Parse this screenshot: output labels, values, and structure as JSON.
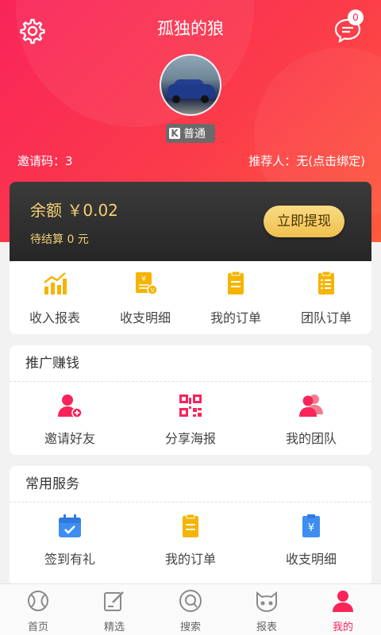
{
  "header": {
    "title": "孤独的狼",
    "message_count": "0",
    "level_badge": "普通",
    "level_icon_letter": "K",
    "invite_code": "邀请码：3",
    "referrer": "推荐人：无(点击绑定)"
  },
  "balance": {
    "label": "余额 ￥0.02",
    "pending": "待结算 0 元",
    "withdraw_button": "立即提现"
  },
  "quick_actions": [
    {
      "label": "收入报表",
      "icon": "chart-icon"
    },
    {
      "label": "收支明细",
      "icon": "ledger-icon"
    },
    {
      "label": "我的订单",
      "icon": "order-icon"
    },
    {
      "label": "团队订单",
      "icon": "team-order-icon"
    }
  ],
  "promo": {
    "title": "推广赚钱",
    "items": [
      {
        "label": "邀请好友",
        "icon": "add-user-icon"
      },
      {
        "label": "分享海报",
        "icon": "qr-code-icon"
      },
      {
        "label": "我的团队",
        "icon": "team-icon"
      }
    ]
  },
  "services": {
    "title": "常用服务",
    "items": [
      {
        "label": "签到有礼",
        "icon": "calendar-check-icon"
      },
      {
        "label": "我的订单",
        "icon": "order-icon"
      },
      {
        "label": "收支明细",
        "icon": "ledger-icon"
      }
    ]
  },
  "tabbar": [
    {
      "label": "首页",
      "icon": "ball-icon"
    },
    {
      "label": "精选",
      "icon": "edit-icon"
    },
    {
      "label": "搜索",
      "icon": "search-icon"
    },
    {
      "label": "报表",
      "icon": "cat-icon"
    },
    {
      "label": "我的",
      "icon": "user-icon",
      "active": true
    }
  ],
  "colors": {
    "accent": "#f9245a",
    "gold": "#f0c04e",
    "icon_yellow": "#f5b400",
    "icon_pink": "#f9245a",
    "icon_blue": "#3d8ef0"
  }
}
